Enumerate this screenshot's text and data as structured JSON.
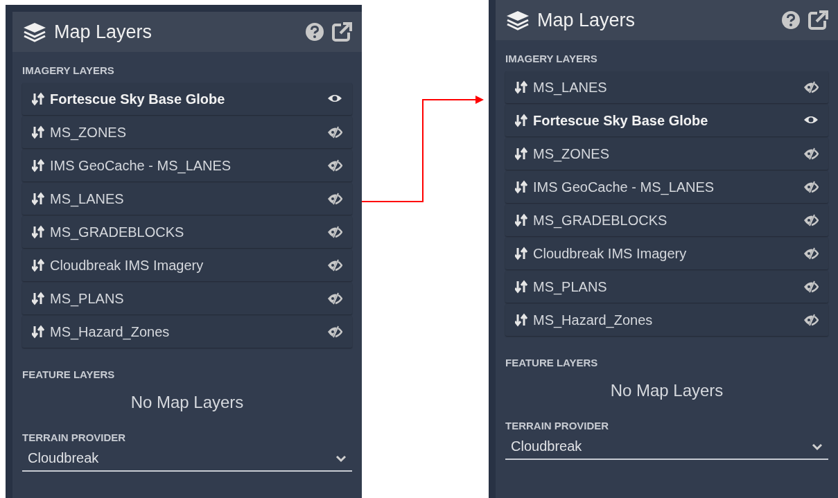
{
  "panels": [
    {
      "title": "Map Layers",
      "imagery_heading": "IMAGERY LAYERS",
      "layers": [
        {
          "name": "Fortescue Sky Base Globe",
          "visible": true
        },
        {
          "name": "MS_ZONES",
          "visible": false
        },
        {
          "name": "IMS GeoCache - MS_LANES",
          "visible": false
        },
        {
          "name": "MS_LANES",
          "visible": false
        },
        {
          "name": "MS_GRADEBLOCKS",
          "visible": false
        },
        {
          "name": "Cloudbreak IMS Imagery",
          "visible": false
        },
        {
          "name": "MS_PLANS",
          "visible": false
        },
        {
          "name": "MS_Hazard_Zones",
          "visible": false
        }
      ],
      "feature_heading": "FEATURE LAYERS",
      "feature_empty": "No Map Layers",
      "terrain_heading": "TERRAIN PROVIDER",
      "terrain_value": "Cloudbreak"
    },
    {
      "title": "Map Layers",
      "imagery_heading": "IMAGERY LAYERS",
      "layers": [
        {
          "name": "MS_LANES",
          "visible": false
        },
        {
          "name": "Fortescue Sky Base Globe",
          "visible": true
        },
        {
          "name": "MS_ZONES",
          "visible": false
        },
        {
          "name": "IMS GeoCache - MS_LANES",
          "visible": false
        },
        {
          "name": "MS_GRADEBLOCKS",
          "visible": false
        },
        {
          "name": "Cloudbreak IMS Imagery",
          "visible": false
        },
        {
          "name": "MS_PLANS",
          "visible": false
        },
        {
          "name": "MS_Hazard_Zones",
          "visible": false
        }
      ],
      "feature_heading": "FEATURE LAYERS",
      "feature_empty": "No Map Layers",
      "terrain_heading": "TERRAIN PROVIDER",
      "terrain_value": "Cloudbreak"
    }
  ]
}
